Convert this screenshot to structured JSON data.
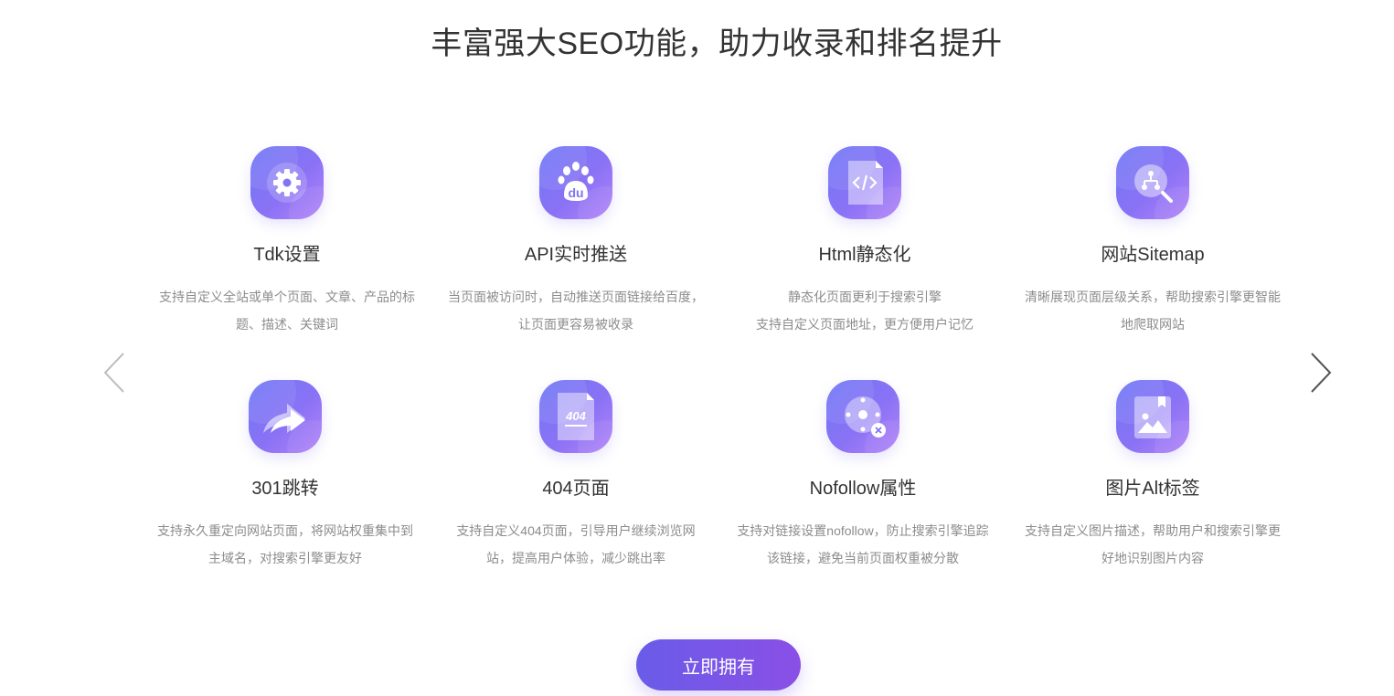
{
  "section": {
    "title": "丰富强大SEO功能，助力收录和排名提升"
  },
  "features": [
    {
      "icon": "gear-icon",
      "title": "Tdk设置",
      "desc": "支持自定义全站或单个页面、文章、产品的标题、描述、关键词"
    },
    {
      "icon": "baidu-paw-icon",
      "title": "API实时推送",
      "desc": "当页面被访问时，自动推送页面链接给百度，让页面更容易被收录"
    },
    {
      "icon": "code-file-icon",
      "title": "Html静态化",
      "desc_lines": [
        "静态化页面更利于搜索引擎",
        "支持自定义页面地址，更方便用户记忆"
      ]
    },
    {
      "icon": "sitemap-search-icon",
      "title": "网站Sitemap",
      "desc": "清晰展现页面层级关系，帮助搜索引擎更智能地爬取网站"
    },
    {
      "icon": "redirect-arrow-icon",
      "title": "301跳转",
      "desc": "支持永久重定向网站页面，将网站权重集中到主域名，对搜索引擎更友好"
    },
    {
      "icon": "404-file-icon",
      "title": "404页面",
      "desc": "支持自定义404页面，引导用户继续浏览网站，提高用户体验，减少跳出率",
      "icon_text": "404"
    },
    {
      "icon": "nofollow-target-icon",
      "title": "Nofollow属性",
      "desc": "支持对链接设置nofollow，防止搜索引擎追踪该链接，避免当前页面权重被分散"
    },
    {
      "icon": "image-alt-icon",
      "title": "图片Alt标签",
      "desc": "支持自定义图片描述，帮助用户和搜索引擎更好地识别图片内容"
    }
  ],
  "nav": {
    "prev_icon": "chevron-left-icon",
    "next_icon": "chevron-right-icon"
  },
  "cta": {
    "label": "立即拥有"
  },
  "colors": {
    "icon_gradient_start": "#6f78f6",
    "icon_gradient_end": "#b383f8",
    "cta_start": "#6a5ce8",
    "cta_end": "#8a4fe6"
  }
}
